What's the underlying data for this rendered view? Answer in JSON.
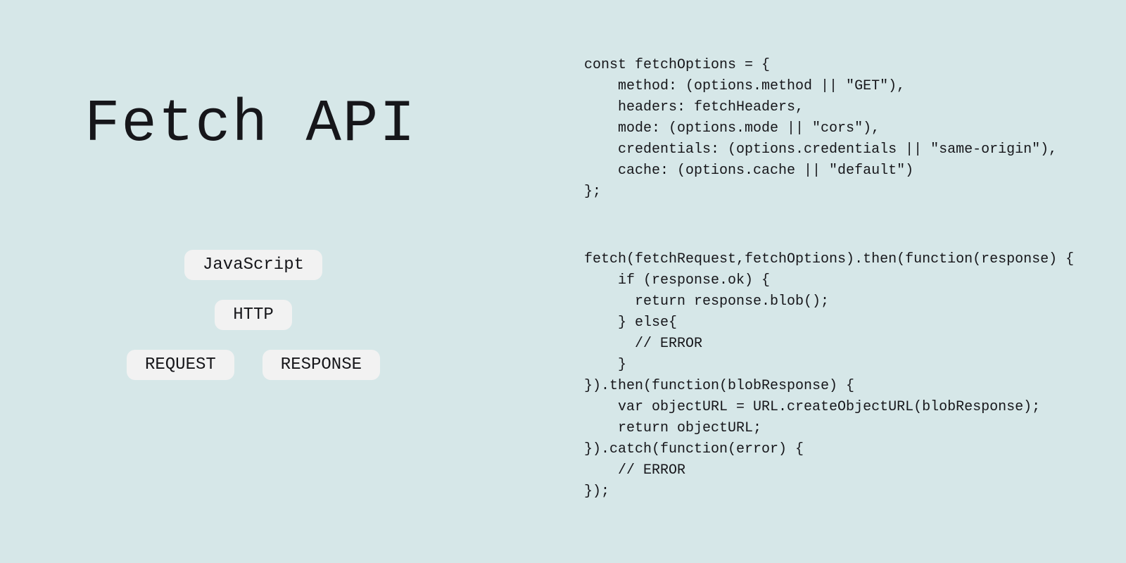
{
  "title": "Fetch API",
  "tags": {
    "row1": {
      "javascript": "JavaScript"
    },
    "row2": {
      "http": "HTTP"
    },
    "row3": {
      "request": "REQUEST",
      "response": "RESPONSE"
    }
  },
  "code": {
    "block1": "const fetchOptions = {\n    method: (options.method || \"GET\"),\n    headers: fetchHeaders,\n    mode: (options.mode || \"cors\"),\n    credentials: (options.credentials || \"same-origin\"),\n    cache: (options.cache || \"default\")\n};",
    "block2": "fetch(fetchRequest,fetchOptions).then(function(response) {\n    if (response.ok) {\n      return response.blob();\n    } else{\n      // ERROR\n    }\n}).then(function(blobResponse) {\n    var objectURL = URL.createObjectURL(blobResponse);\n    return objectURL;\n}).catch(function(error) {\n    // ERROR\n});"
  }
}
